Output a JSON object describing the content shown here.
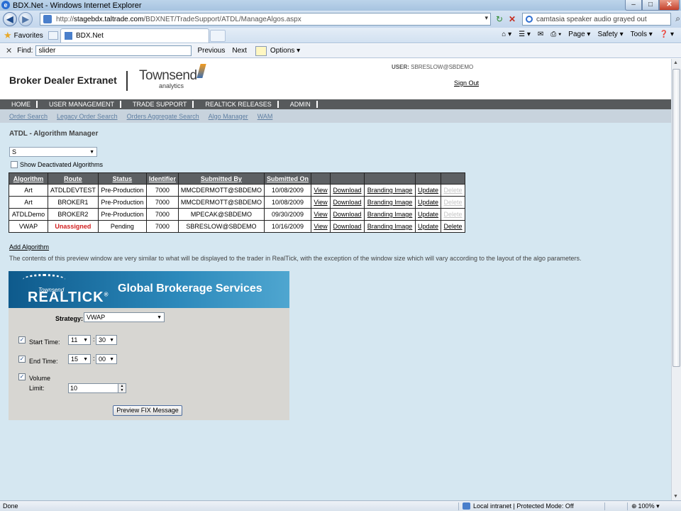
{
  "window": {
    "title": "BDX.Net - Windows Internet Explorer",
    "controls": {
      "minimize": "–",
      "maximize": "□",
      "close": "✕"
    }
  },
  "browser": {
    "address_prefix": "http://",
    "address_host": "stagebdx.taltrade.com",
    "address_path": "/BDXNET/TradeSupport/ATDL/ManageAlgos.aspx",
    "search_text": "camtasia speaker audio grayed out",
    "favorites_label": "Favorites",
    "tab_title": "BDX.Net",
    "commands": [
      "Page ▾",
      "Safety ▾",
      "Tools ▾",
      "❓ ▾"
    ],
    "find_label": "Find:",
    "find_value": "slider",
    "find_previous": "Previous",
    "find_next": "Next",
    "find_options": "Options ▾"
  },
  "header": {
    "brand": "Broker Dealer Extranet",
    "logo_name": "Townsend",
    "logo_sub": "analytics",
    "user_label": "USER:",
    "user_value": "SBRESLOW@SBDEMO",
    "signout": "Sign Out"
  },
  "menu": [
    "HOME",
    "USER MANAGEMENT",
    "TRADE SUPPORT",
    "REALTICK RELEASES",
    "ADMIN"
  ],
  "submenu": [
    "Order Search",
    "Legacy Order Search",
    "Orders Aggregate Search",
    "Algo Manager",
    "WAM"
  ],
  "page": {
    "title": "ATDL - Algorithm Manager",
    "filter_value": "S",
    "show_deactivated": "Show Deactivated Algorithms",
    "add_algorithm": "Add Algorithm",
    "preview_note": "The contents of this preview window are very similar to what will be displayed to the trader in RealTick, with the exception of the window size which will vary according to the layout of the algo parameters."
  },
  "table": {
    "headers": [
      "Algorithm",
      "Route",
      "Status",
      "Identifier",
      "Submitted By",
      "Submitted On",
      "",
      "",
      "",
      "",
      ""
    ],
    "rows": [
      [
        "Art",
        "ATDLDEVTEST",
        "Pre-Production",
        "7000",
        "MMCDERMOTT@SBDEMO",
        "10/08/2009",
        "View",
        "Download",
        "Branding Image",
        "Update",
        "Delete"
      ],
      [
        "Art",
        "BROKER1",
        "Pre-Production",
        "7000",
        "MMCDERMOTT@SBDEMO",
        "10/08/2009",
        "View",
        "Download",
        "Branding Image",
        "Update",
        "Delete"
      ],
      [
        "ATDLDemo",
        "BROKER2",
        "Pre-Production",
        "7000",
        "MPECAK@SBDEMO",
        "09/30/2009",
        "View",
        "Download",
        "Branding Image",
        "Update",
        "Delete"
      ],
      [
        "VWAP",
        "Unassigned",
        "Pending",
        "7000",
        "SBRESLOW@SBDEMO",
        "10/16/2009",
        "View",
        "Download",
        "Branding Image",
        "Update",
        "Delete"
      ]
    ]
  },
  "preview": {
    "banner_small": "Townsend",
    "banner_big": "REALTICK",
    "banner_tm": "®",
    "banner_title": "Global Brokerage Services",
    "strategy_label": "Strategy:",
    "strategy_value": "VWAP",
    "start_label": "Start Time:",
    "start_hour": "11",
    "start_min": "30",
    "end_label": "End Time:",
    "end_hour": "15",
    "end_min": "00",
    "volume_label": "Volume",
    "limit_label": "Limit:",
    "limit_value": "10",
    "colon": ":",
    "preview_button": "Preview FIX Message",
    "check_mark": "✓"
  },
  "status": {
    "left": "Done",
    "zone": "Local intranet | Protected Mode: Off",
    "zoom": "100%"
  },
  "colors": {
    "page_bg": "#d5e7f1",
    "menu_bg": "#575a5c",
    "table_header_bg": "#5d6063",
    "unassigned_red": "#d21f1f"
  }
}
